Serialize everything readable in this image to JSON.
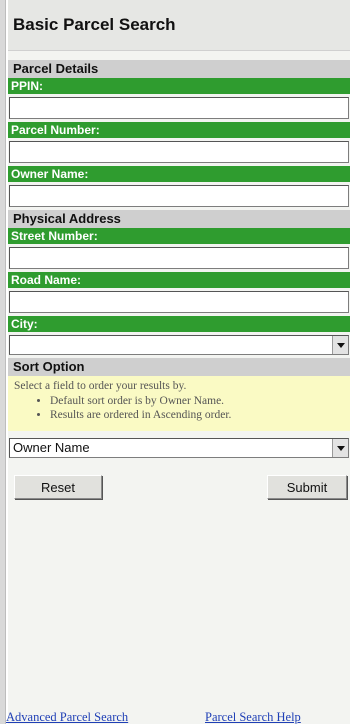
{
  "title": "Basic Parcel Search",
  "parcel_details": {
    "header": "Parcel Details",
    "fields": [
      {
        "label": "PPIN:",
        "value": ""
      },
      {
        "label": "Parcel Number:",
        "value": ""
      },
      {
        "label": "Owner Name:",
        "value": ""
      }
    ]
  },
  "physical_address": {
    "header": "Physical Address",
    "street_number": {
      "label": "Street Number:",
      "value": ""
    },
    "road_name": {
      "label": "Road Name:",
      "value": ""
    },
    "city": {
      "label": "City:",
      "selected": ""
    }
  },
  "sort_option": {
    "header": "Sort Option",
    "help_text": "Select a field to order your results by.",
    "bullets": [
      "Default sort order is by Owner Name.",
      "Results are ordered in Ascending order."
    ],
    "selected": "Owner Name"
  },
  "buttons": {
    "reset": "Reset",
    "submit": "Submit"
  },
  "links": {
    "advanced": "Advanced Parcel Search",
    "help": "Parcel Search Help"
  },
  "colors": {
    "green_label": "#2f9c2f",
    "section_gray": "#cfcfcf",
    "help_yellow": "#fafac4",
    "link_blue": "#1f3fb6"
  },
  "icons": {
    "dropdown": "chevron-down-icon"
  }
}
